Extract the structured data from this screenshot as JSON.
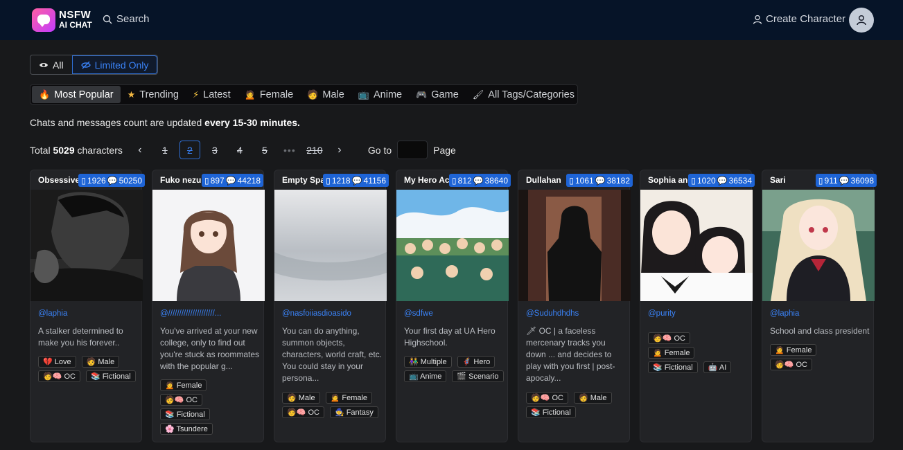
{
  "header": {
    "brand_top": "NSFW",
    "brand_bottom": "AI CHAT",
    "search_label": "Search",
    "create_label": "Create Character"
  },
  "filters": {
    "all_label": "All",
    "limited_label": "Limited Only"
  },
  "tabs": [
    {
      "icon": "🔥",
      "label": "Most Popular"
    },
    {
      "icon": "★",
      "label": "Trending"
    },
    {
      "icon": "⚡",
      "label": "Latest"
    },
    {
      "icon": "🙍",
      "label": "Female"
    },
    {
      "icon": "🧑",
      "label": "Male"
    },
    {
      "icon": "📺",
      "label": "Anime"
    },
    {
      "icon": "🎮",
      "label": "Game"
    },
    {
      "icon": "🖌",
      "label": "All Tags/Categories"
    }
  ],
  "notice": {
    "text": "Chats and messages count are updated ",
    "bold": "every 15-30 minutes."
  },
  "pagination": {
    "total_prefix": "Total ",
    "total_count": "5029",
    "total_suffix": " characters",
    "prev": "‹",
    "next": "›",
    "pages": [
      "1",
      "2",
      "3",
      "4",
      "5",
      "•••",
      "210"
    ],
    "current": "2",
    "goto_label": "Go to",
    "page_label": "Page"
  },
  "cards": [
    {
      "title": "Obsessive Stalker",
      "chats": "1926",
      "messages": "50250",
      "handle": "@laphia",
      "desc": "A stalker determined to make you his forever..",
      "tags": [
        "💔 Love",
        "🧑 Male",
        "🧑🧠 OC",
        "📚 Fictional"
      ]
    },
    {
      "title": "Fuko nezuhara",
      "chats": "897",
      "messages": "44218",
      "handle": "@/////////////////////...",
      "desc": "You've arrived at your new college, only to find out you're stuck as roommates with the popular g...",
      "tags": [
        "🙍 Female",
        "🧑🧠 OC",
        "📚 Fictional",
        "🌸 Tsundere"
      ]
    },
    {
      "title": "Empty Space",
      "chats": "1218",
      "messages": "41156",
      "handle": "@nasfoiiasdioasido",
      "desc": "You can do anything, summon objects, characters, world craft, etc. You could stay in your persona...",
      "tags": [
        "🧑 Male",
        "🙍 Female",
        "🧑🧠 OC",
        "🧙 Fantasy"
      ]
    },
    {
      "title": "My Hero Academia",
      "chats": "812",
      "messages": "38640",
      "handle": "@sdfwe",
      "desc": "Your first day at UA Hero Highschool.",
      "tags": [
        "👫 Multiple",
        "🦸 Hero",
        "📺 Anime",
        "🎬 Scenario"
      ]
    },
    {
      "title": "Dullahan",
      "chats": "1061",
      "messages": "38182",
      "handle": "@Suduhdhdhs",
      "desc": "🗡 OC | a faceless mercenary tracks you down ... and decides to play with you first | post-apocaly...",
      "tags": [
        "🧑🧠 OC",
        "🧑 Male",
        "📚 Fictional"
      ]
    },
    {
      "title": "Sophia and Kaori",
      "chats": "1020",
      "messages": "36534",
      "handle": "@purity",
      "desc": "",
      "tags": [
        "🧑🧠 OC",
        "🙍 Female",
        "📚 Fictional",
        "🤖 AI"
      ]
    },
    {
      "title": "Sari",
      "chats": "911",
      "messages": "36098",
      "handle": "@laphia",
      "desc": "School and class president",
      "tags": [
        "🙍 Female",
        "🧑🧠 OC"
      ]
    }
  ]
}
